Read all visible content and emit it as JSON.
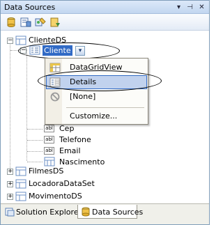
{
  "window": {
    "title": "Data Sources"
  },
  "titlebar": {
    "buttons": [
      "▾",
      "⊣",
      "✕"
    ]
  },
  "toolbar": {
    "tools": [
      "add-new-data-source-icon",
      "edit-dataset-designer-icon",
      "configure-dataset-icon",
      "refresh-icon"
    ]
  },
  "tree": {
    "root": {
      "label": "ClienteDS",
      "expander": "−"
    },
    "cliente": {
      "label": "Cliente",
      "expander": "−",
      "dropdown": "▾"
    },
    "fields": [
      {
        "label": "Cep",
        "icon": "abl"
      },
      {
        "label": "Telefone",
        "icon": "abl"
      },
      {
        "label": "Email",
        "icon": "abl"
      },
      {
        "label": "Nascimento",
        "icon": "grid"
      }
    ],
    "other": [
      {
        "label": "FilmesDS",
        "expander": "+"
      },
      {
        "label": "LocadoraDataSet",
        "expander": "+"
      },
      {
        "label": "MovimentoDS",
        "expander": "+"
      }
    ]
  },
  "menu": {
    "items": [
      {
        "label": "DataGridView",
        "icon": "datagridview-icon"
      },
      {
        "label": "Details",
        "icon": "details-icon"
      },
      {
        "label": "[None]",
        "icon": "none-icon"
      },
      {
        "label": "Customize...",
        "icon": ""
      }
    ]
  },
  "tabs": [
    {
      "label": "Solution Explorer",
      "icon": "solution-explorer-icon"
    },
    {
      "label": "Data Sources",
      "icon": "data-sources-icon"
    }
  ]
}
